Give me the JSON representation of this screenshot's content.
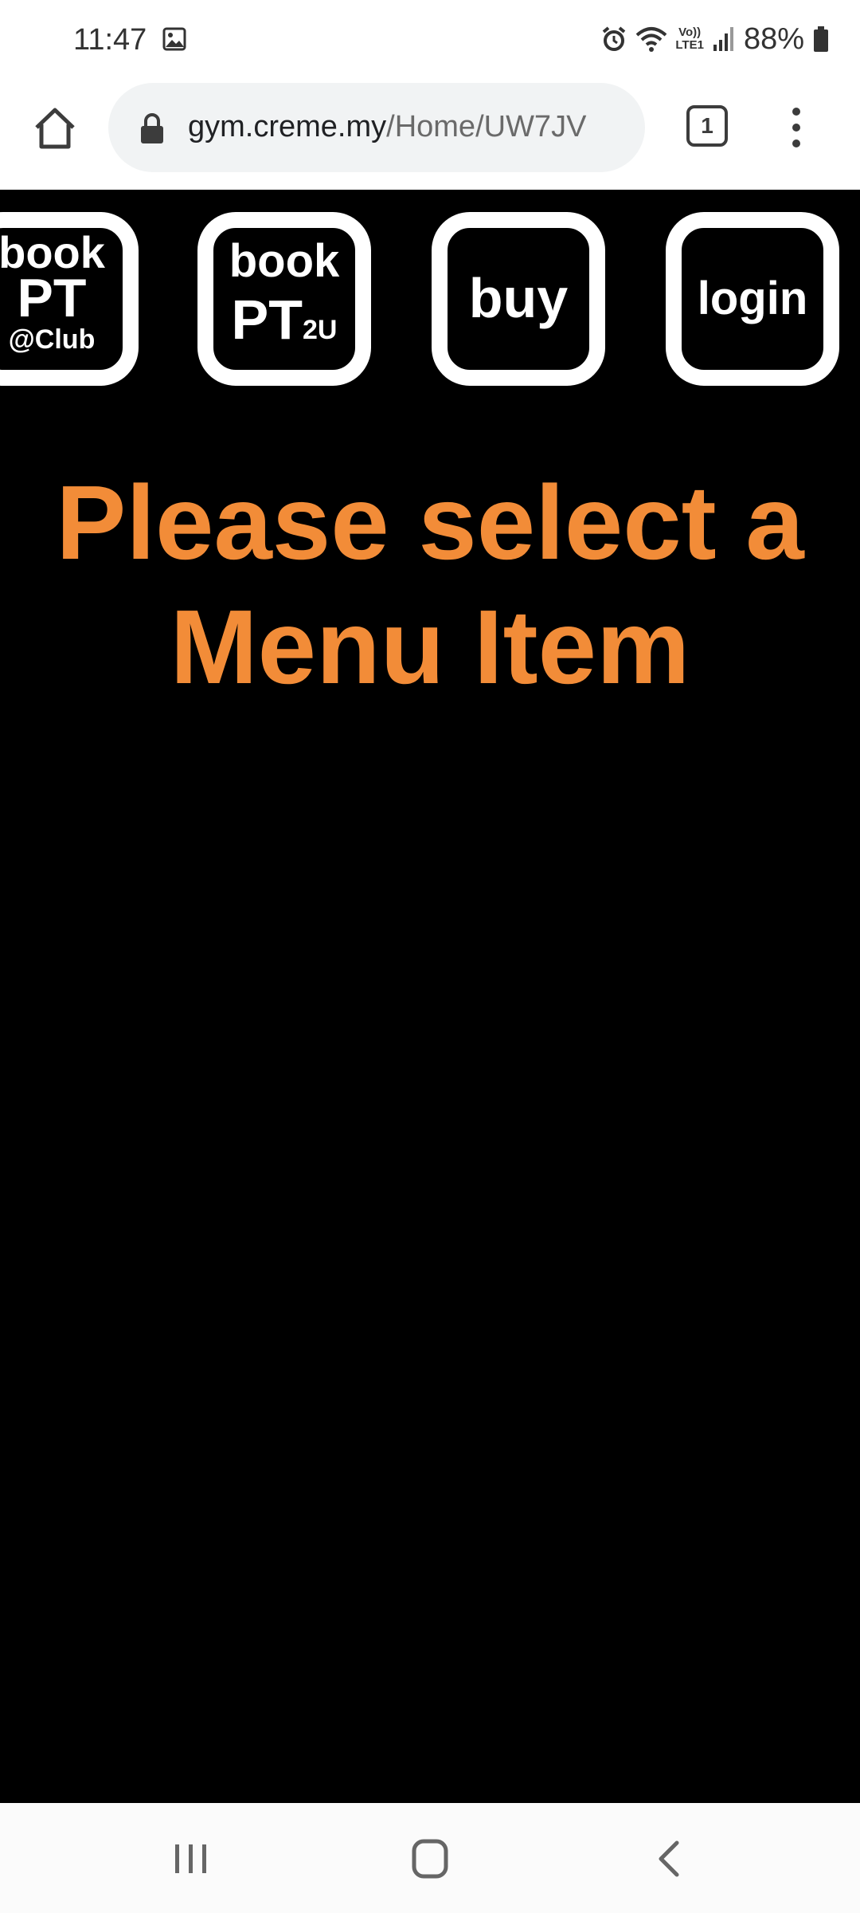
{
  "status_bar": {
    "time": "11:47",
    "battery": "88%",
    "network_label": "LTE1",
    "icons": [
      "gallery-icon",
      "alarm-icon",
      "wifi-icon",
      "volte-icon",
      "signal-icon",
      "battery-icon"
    ]
  },
  "browser": {
    "url_host": "gym.creme.my",
    "url_path": "/Home/UW7JV",
    "tab_count": "1",
    "icons": [
      "home-icon",
      "lock-icon",
      "tabs-icon",
      "more-vert-icon"
    ]
  },
  "menu": {
    "tiles": [
      {
        "line1": "book",
        "line2": "PT",
        "line3": "@Club"
      },
      {
        "line1": "book",
        "line2": "PT",
        "line2_sub": "2U"
      },
      {
        "line1": "buy"
      },
      {
        "line1": "login"
      }
    ]
  },
  "main": {
    "headline_line1": "Please select a",
    "headline_line2": "Menu Item",
    "headline_color": "#f28c38",
    "background": "#000000"
  },
  "nav_bar": {
    "icons": [
      "recent-apps-icon",
      "home-nav-icon",
      "back-icon"
    ]
  }
}
